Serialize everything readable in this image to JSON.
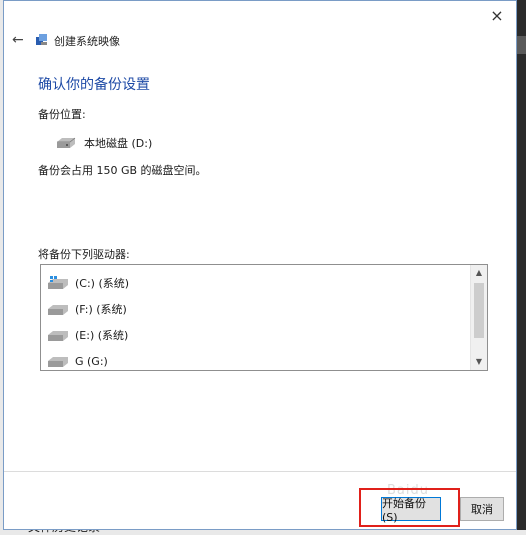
{
  "dialog": {
    "title": "创建系统映像",
    "heading": "确认你的备份设置",
    "backup_location_label": "备份位置:",
    "backup_drive": "本地磁盘 (D:)",
    "space_text": "备份会占用 150 GB 的磁盘空间。",
    "list_label": "将备份下列驱动器:",
    "drives": [
      {
        "label": "(C:) (系统)",
        "icon": "windows-disk-icon"
      },
      {
        "label": "(F:) (系统)",
        "icon": "disk-icon"
      },
      {
        "label": "(E:) (系统)",
        "icon": "disk-icon"
      },
      {
        "label": "G (G:)",
        "icon": "disk-icon"
      }
    ],
    "start_button": "开始备份(S)",
    "cancel_button": "取消",
    "close_glyph": "×",
    "back_glyph": "←"
  },
  "background": {
    "bottom_text": "文件历史记录"
  },
  "watermark": "Baidu"
}
